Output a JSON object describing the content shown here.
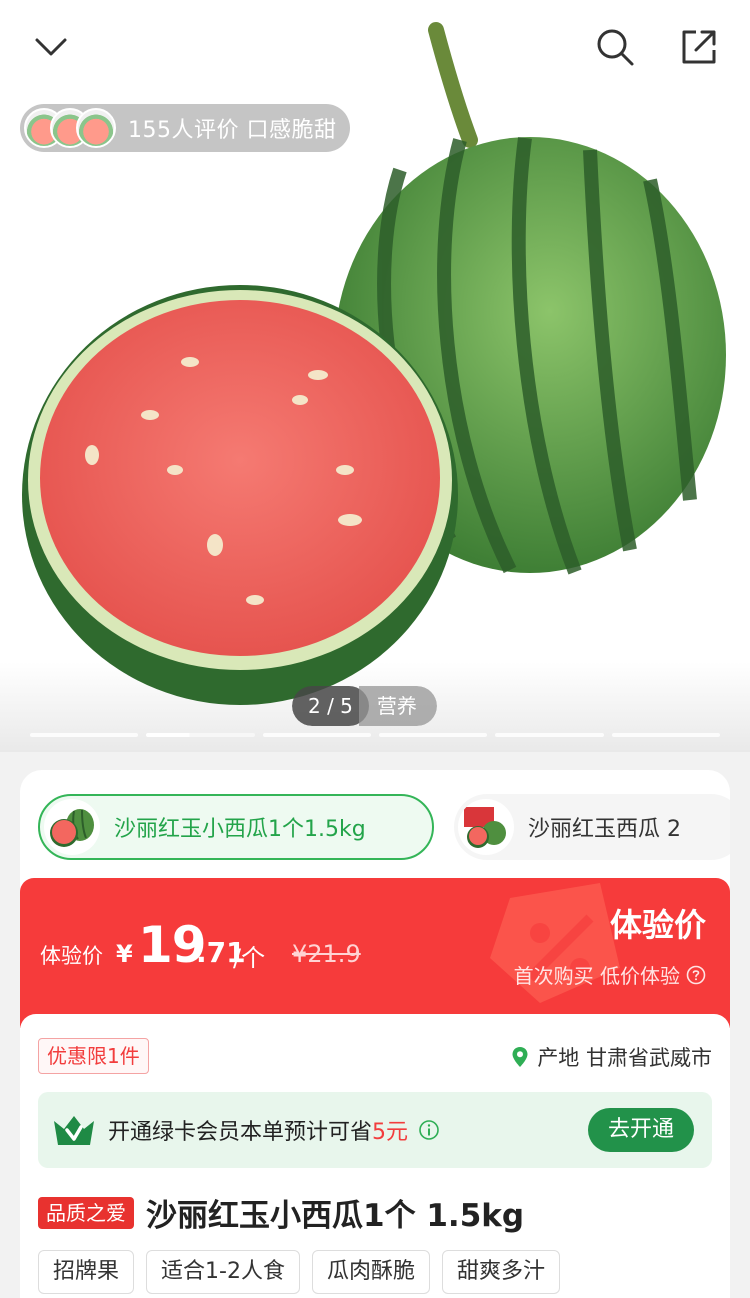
{
  "hero": {
    "review_text": "155人评价  口感脆甜",
    "pager": {
      "current": "2 / 5",
      "tab": "营养"
    },
    "progress": {
      "segments": 6,
      "active": 2
    }
  },
  "variants": [
    {
      "label": "沙丽红玉小西瓜1个1.5kg",
      "selected": true
    },
    {
      "label": "沙丽红玉西瓜 2",
      "selected": false
    }
  ],
  "price": {
    "label": "体验价",
    "currency": "¥",
    "integer": "19",
    "decimal": ".71",
    "unit": "/个",
    "original": "¥21.9",
    "exp_title": "体验价",
    "exp_sub": "首次购买 低价体验"
  },
  "info": {
    "limit": "优惠限1件",
    "origin": "产地 甘肃省武威市",
    "member": {
      "text_before": "开通绿卡会员本单预计可省",
      "amount": "5元",
      "button": "去开通"
    },
    "quality_tag": "品质之爱",
    "title": "沙丽红玉小西瓜1个 1.5kg",
    "tags": [
      "招牌果",
      "适合1-2人食",
      "瓜肉酥脆",
      "甜爽多汁"
    ]
  },
  "colors": {
    "accent_green": "#34b558",
    "price_red": "#f63b3b",
    "member_green": "#22924a"
  }
}
